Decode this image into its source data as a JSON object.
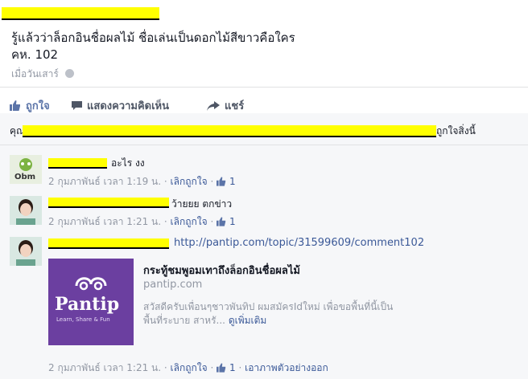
{
  "post": {
    "line1": "รู้แล้วว่าล็อกอินชื่อผลไม้ ชื่อเล่นเป็นดอกไม้สีขาวคือใคร",
    "line2": "คห. 102",
    "timestamp": "เมื่อวันเสาร์"
  },
  "actions": {
    "like": "ถูกใจ",
    "comment": "แสดงความคิดเห็น",
    "share": "แชร์"
  },
  "likes_summary": {
    "prefix": "คุณ",
    "suffix": "ถูกใจสิ่งนี้"
  },
  "comments": [
    {
      "text": "อะไร งง",
      "time": "2 กุมภาพันธ์ เวลา 1:19 น.",
      "unlike": "เลิกถูกใจ",
      "likes": "1"
    },
    {
      "text": "ว้ายยย ตกข่าว",
      "time": "2 กุมภาพันธ์ เวลา 1:21 น.",
      "unlike": "เลิกถูกใจ",
      "likes": "1"
    },
    {
      "link": "http://pantip.com/topic/31599609/comment102",
      "time": "2 กุมภาพันธ์ เวลา 1:21 น.",
      "unlike": "เลิกถูกใจ",
      "likes": "1",
      "remove_preview": "เอาภาพตัวอย่างออก"
    }
  ],
  "preview": {
    "title": "กระทู้ชมพูอมเทาถึงล็อกอินชื่อผลไม้",
    "domain": "pantip.com",
    "desc_line1": "สวัสดีครับเพื่อนๆชาวพันทิป ผมสมัครIdใหม่ เพื่อขอพื้นที่นี้เป็น",
    "desc_line2": "พื้นที่ระบาย สาหรั...",
    "see_more": "ดูเพิ่มเติม",
    "logo_text": "Pantip",
    "tagline": "Learn, Share & Fun"
  },
  "avatar1_caption": "Obm",
  "colors": {
    "redaction": "#ffff00",
    "link": "#3b5998",
    "like_blue": "#5b74a8",
    "pantip_purple": "#6b3fa0"
  }
}
